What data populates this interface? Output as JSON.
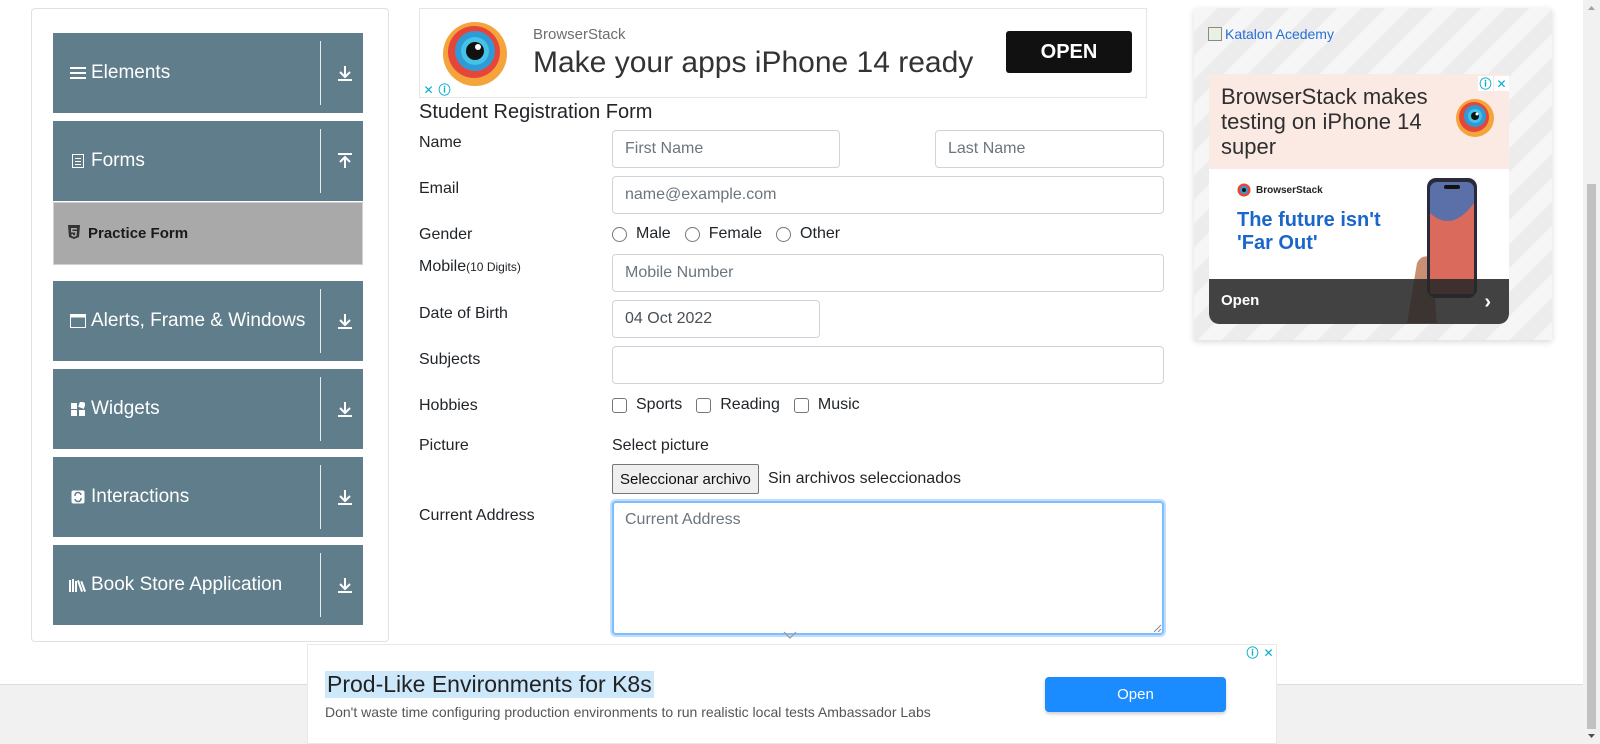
{
  "sidebar": {
    "groups": [
      {
        "label": "Elements",
        "icon": "hamburger-icon",
        "toggle": "expand"
      },
      {
        "label": "Forms",
        "icon": "document-icon",
        "toggle": "collapse"
      },
      {
        "label": "Alerts, Frame & Windows",
        "icon": "window-icon",
        "toggle": "expand"
      },
      {
        "label": "Widgets",
        "icon": "widgets-icon",
        "toggle": "expand"
      },
      {
        "label": "Interactions",
        "icon": "interactions-icon",
        "toggle": "expand"
      },
      {
        "label": "Book Store Application",
        "icon": "books-icon",
        "toggle": "expand"
      }
    ],
    "active_item": {
      "label": "Practice Form",
      "icon": "html5-icon"
    }
  },
  "top_ad": {
    "brand": "BrowserStack",
    "headline": "Make your apps iPhone 14 ready",
    "button": "OPEN"
  },
  "form": {
    "title": "Student Registration Form",
    "name_label": "Name",
    "first_name_placeholder": "First Name",
    "last_name_placeholder": "Last Name",
    "email_label": "Email",
    "email_placeholder": "name@example.com",
    "gender_label": "Gender",
    "gender_options": [
      "Male",
      "Female",
      "Other"
    ],
    "mobile_label": "Mobile",
    "mobile_hint": "(10 Digits)",
    "mobile_placeholder": "Mobile Number",
    "dob_label": "Date of Birth",
    "dob_value": "04 Oct 2022",
    "subjects_label": "Subjects",
    "subjects_value": "",
    "hobbies_label": "Hobbies",
    "hobbies_options": [
      "Sports",
      "Reading",
      "Music"
    ],
    "picture_label": "Picture",
    "picture_prompt": "Select picture",
    "file_button": "Seleccionar archivo",
    "file_status": "Sin archivos seleccionados",
    "address_label": "Current Address",
    "address_placeholder": "Current Address"
  },
  "right_ad": {
    "broken_image_alt": "Katalon Acedemy",
    "headline": "BrowserStack makes testing on iPhone 14 super",
    "mini_brand": "BrowserStack",
    "tagline": "The future isn't 'Far Out'",
    "button": "Open"
  },
  "bottom_ad": {
    "headline": "Prod-Like Environments for K8s",
    "subtext": "Don't waste time configuring production environments to run realistic local tests Ambassador Labs",
    "button": "Open"
  },
  "colors": {
    "sidebar_header": "#607d8b",
    "active_item": "#a9a9a9",
    "ad_open_button": "#1a8cff",
    "focus_border": "#80bdff",
    "tagline_blue": "#1b67c9"
  }
}
